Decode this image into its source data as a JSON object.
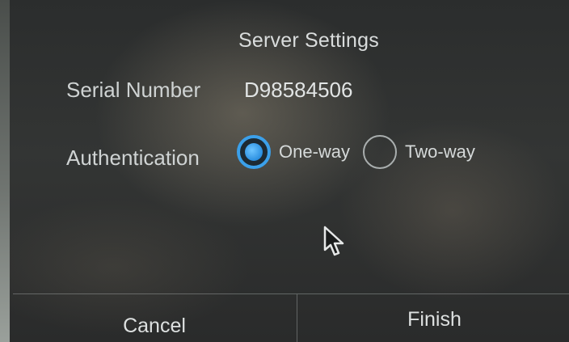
{
  "dialog": {
    "title": "Server Settings",
    "serial_label": "Serial Number",
    "serial_value": "D98584506",
    "auth_label": "Authentication",
    "auth_options": [
      {
        "label": "One-way",
        "selected": true
      },
      {
        "label": "Two-way",
        "selected": false
      }
    ],
    "cancel_label": "Cancel",
    "finish_label": "Finish"
  },
  "colors": {
    "accent": "#3ba0ea",
    "text": "#d9dcdc",
    "background": "#2b2d2d"
  },
  "icons": {
    "cursor": "mouse-pointer-icon"
  }
}
